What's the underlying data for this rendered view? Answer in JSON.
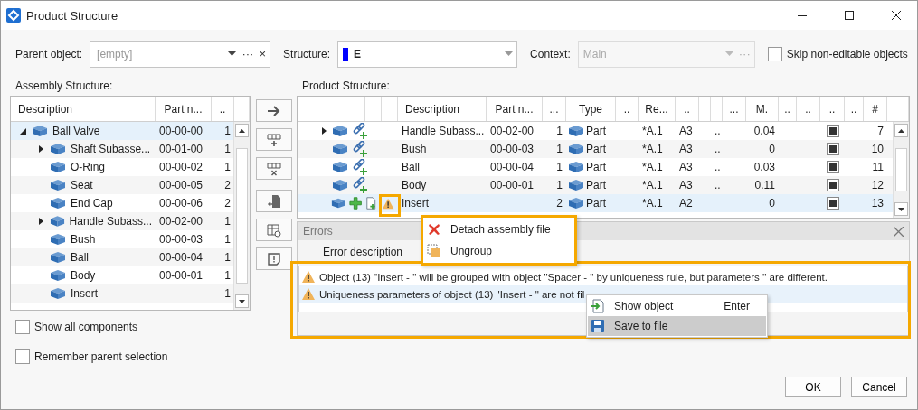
{
  "window": {
    "title": "Product Structure"
  },
  "parent_object": {
    "label": "Parent object:",
    "placeholder": "[empty]",
    "more": "···",
    "clear": "×"
  },
  "structure": {
    "label": "Structure:",
    "value": "E",
    "color": "#0000ff"
  },
  "context": {
    "label": "Context:",
    "value": "Main",
    "disabled": true,
    "more": "···"
  },
  "skip_non_editable": {
    "label": "Skip non-editable objects",
    "checked": false
  },
  "assembly_structure": {
    "label": "Assembly Structure:",
    "columns": [
      "Description",
      "Part n...",
      ".."
    ],
    "items": [
      {
        "description": "Ball Valve",
        "part_no": "00-00-00",
        "qty": "1",
        "expanded": true,
        "selected": true,
        "children": [
          {
            "description": "Shaft Subasse...",
            "part_no": "00-01-00",
            "qty": "1",
            "expanded": false,
            "selected": false
          },
          {
            "description": "O-Ring",
            "part_no": "00-00-02",
            "qty": "1",
            "selected": false
          },
          {
            "description": "Seat",
            "part_no": "00-00-05",
            "qty": "2",
            "selected": false
          },
          {
            "description": "End Cap",
            "part_no": "00-00-06",
            "qty": "2",
            "selected": false
          },
          {
            "description": "Handle Subass...",
            "part_no": "00-02-00",
            "qty": "1",
            "expanded": false,
            "selected": false
          },
          {
            "description": "Bush",
            "part_no": "00-00-03",
            "qty": "1",
            "selected": false
          },
          {
            "description": "Ball",
            "part_no": "00-00-04",
            "qty": "1",
            "selected": false
          },
          {
            "description": "Body",
            "part_no": "00-00-01",
            "qty": "1",
            "selected": false
          },
          {
            "description": "Insert",
            "qty": "1",
            "selected": false
          }
        ]
      }
    ]
  },
  "product_structure": {
    "label": "Product Structure:",
    "columns": [
      {
        "kind": "text",
        "label": "Description"
      },
      {
        "kind": "text",
        "label": "Part n..."
      },
      {
        "kind": "text",
        "label": "..."
      },
      {
        "kind": "text",
        "label": "Type"
      },
      {
        "kind": "text",
        "label": ".."
      },
      {
        "kind": "text",
        "label": "Re..."
      },
      {
        "kind": "text",
        "label": ".."
      },
      {
        "kind": "blank"
      },
      {
        "kind": "blank"
      },
      {
        "kind": "text",
        "label": "..."
      },
      {
        "kind": "text",
        "label": "M."
      },
      {
        "kind": "text",
        "label": ".."
      },
      {
        "kind": "text",
        "label": ".."
      },
      {
        "kind": "text",
        "label": ".."
      },
      {
        "kind": "text",
        "label": ".."
      },
      {
        "kind": "text",
        "label": "#"
      }
    ],
    "rows": [
      {
        "expanded": false,
        "kind": "linked",
        "warning": false,
        "description": "Handle Subass...",
        "part_no": "00-02-00",
        "qty": "1",
        "type": "Part",
        "rev": "*A.1",
        "format": "A3",
        "flag": "..",
        "mass": "0.04",
        "checked": true,
        "number": "7",
        "selected": false
      },
      {
        "kind": "linked",
        "warning": false,
        "description": "Bush",
        "part_no": "00-00-03",
        "qty": "1",
        "type": "Part",
        "rev": "*A.1",
        "format": "A3",
        "flag": "..",
        "mass": "0",
        "checked": true,
        "number": "10",
        "selected": false
      },
      {
        "kind": "linked",
        "warning": false,
        "description": "Ball",
        "part_no": "00-00-04",
        "qty": "1",
        "type": "Part",
        "rev": "*A.1",
        "format": "A3",
        "flag": "..",
        "mass": "0.03",
        "checked": true,
        "number": "11",
        "selected": false
      },
      {
        "kind": "linked",
        "warning": false,
        "description": "Body",
        "part_no": "00-00-01",
        "qty": "1",
        "type": "Part",
        "rev": "*A.1",
        "format": "A3",
        "flag": "..",
        "mass": "0.11",
        "checked": true,
        "number": "12",
        "selected": false
      },
      {
        "kind": "new",
        "warning": true,
        "description": "Insert",
        "qty": "2",
        "type": "Part",
        "rev": "*A.1",
        "format": "A2",
        "mass": "0",
        "checked": true,
        "number": "13",
        "selected": true
      }
    ]
  },
  "errors": {
    "title": "Errors",
    "column": "Error description",
    "rows": [
      {
        "text": "Object (13) \"Insert - \" will be grouped with object \"Spacer - \" by uniqueness rule, but parameters '' are different.",
        "selected": false
      },
      {
        "text": "Uniqueness parameters of object (13) \"Insert - \" are not fil",
        "selected": true
      }
    ]
  },
  "row_menu": {
    "items": [
      {
        "kind": "detach",
        "label": "Detach assembly file"
      },
      {
        "kind": "ungroup",
        "label": "Ungroup"
      }
    ]
  },
  "error_menu": {
    "items": [
      {
        "kind": "show",
        "label": "Show object",
        "shortcut": "Enter",
        "selected": false
      },
      {
        "kind": "save",
        "label": "Save to file",
        "selected": true
      }
    ]
  },
  "show_all_components": {
    "label": "Show all components",
    "checked": false
  },
  "remember_parent_selection": {
    "label": "Remember parent selection",
    "checked": false
  },
  "buttons": [
    "OK",
    "Cancel"
  ]
}
